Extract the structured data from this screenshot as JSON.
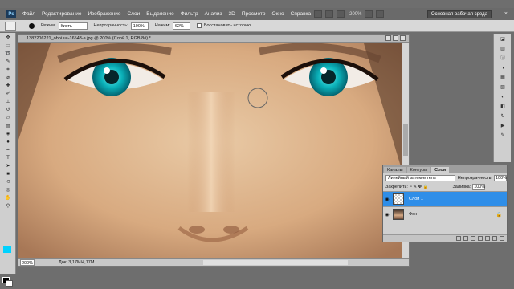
{
  "menubar": {
    "logo": "Ps",
    "items": [
      "Файл",
      "Редактирование",
      "Изображение",
      "Слои",
      "Выделение",
      "Фильтр",
      "Анализ",
      "3D",
      "Просмотр",
      "Окно",
      "Справка"
    ],
    "zoom": "200%",
    "workspace": "Основная рабочая среда",
    "minimize": "–",
    "close": "×"
  },
  "options": {
    "mode_label": "Режим:",
    "mode_value": "Кисть",
    "opacity_label": "Непрозрачность:",
    "opacity_value": "100%",
    "pressure_label": "Нажим:",
    "pressure_value": "62%",
    "restore_label": "Восстановить историю"
  },
  "document": {
    "title": "1382206221_oboi.ua-16543-a.jpg @ 200% (Слой 1, RGB/8#) *",
    "zoom": "200%",
    "info": "Док: 3,17M/4,17M"
  },
  "layers_panel": {
    "tabs": [
      "Каналы",
      "Контуры",
      "Слои"
    ],
    "active_tab": 2,
    "blend_mode": "Линейный затемнитель",
    "opacity_label": "Непрозрачность:",
    "opacity_value": "100%",
    "lock_label": "Закрепить:",
    "fill_label": "Заливка:",
    "fill_value": "100%",
    "layers": [
      {
        "name": "Слой 1",
        "selected": true
      },
      {
        "name": "Фон",
        "selected": false
      }
    ]
  },
  "colors": {
    "accent": "#2f8ee8",
    "iris": "#0ab0b8",
    "foreground": "#000000",
    "background": "#ffffff"
  }
}
